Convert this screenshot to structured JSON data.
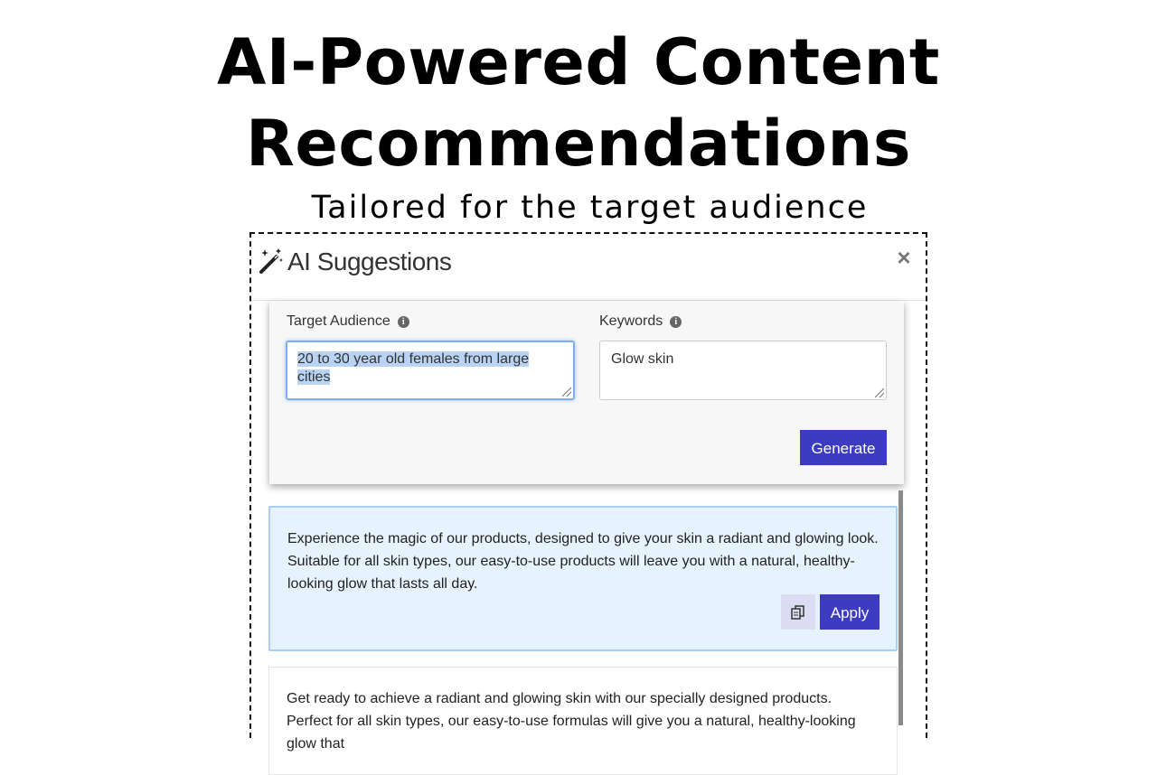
{
  "hero": {
    "title_line1": "AI-Powered Content",
    "title_line2": "Recommendations",
    "subtitle": "Tailored for the target audience"
  },
  "panel": {
    "title": "AI Suggestions",
    "close_label": "×",
    "title_icon": "magic-wand-icon"
  },
  "form": {
    "audience_label": "Target Audience",
    "audience_value": "20 to 30 year old females from large cities",
    "keywords_label": "Keywords",
    "keywords_value": "Glow skin",
    "info_glyph": "i",
    "generate_label": "Generate"
  },
  "suggestions": [
    {
      "text": "Experience the magic of our products, designed to give your skin a radiant and glowing look. Suitable for all skin types, our easy-to-use products will leave you with a natural, healthy-looking glow that lasts all day.",
      "apply_label": "Apply",
      "copy_icon": "copy-icon"
    },
    {
      "text": "Get ready to achieve a radiant and glowing skin with our specially designed products. Perfect for all skin types, our easy-to-use formulas will give you a natural, healthy-looking glow that"
    }
  ],
  "colors": {
    "accent": "#3d3bbf",
    "selected_card_bg": "#e6f2fd",
    "selected_card_border": "#a9d0f2"
  }
}
